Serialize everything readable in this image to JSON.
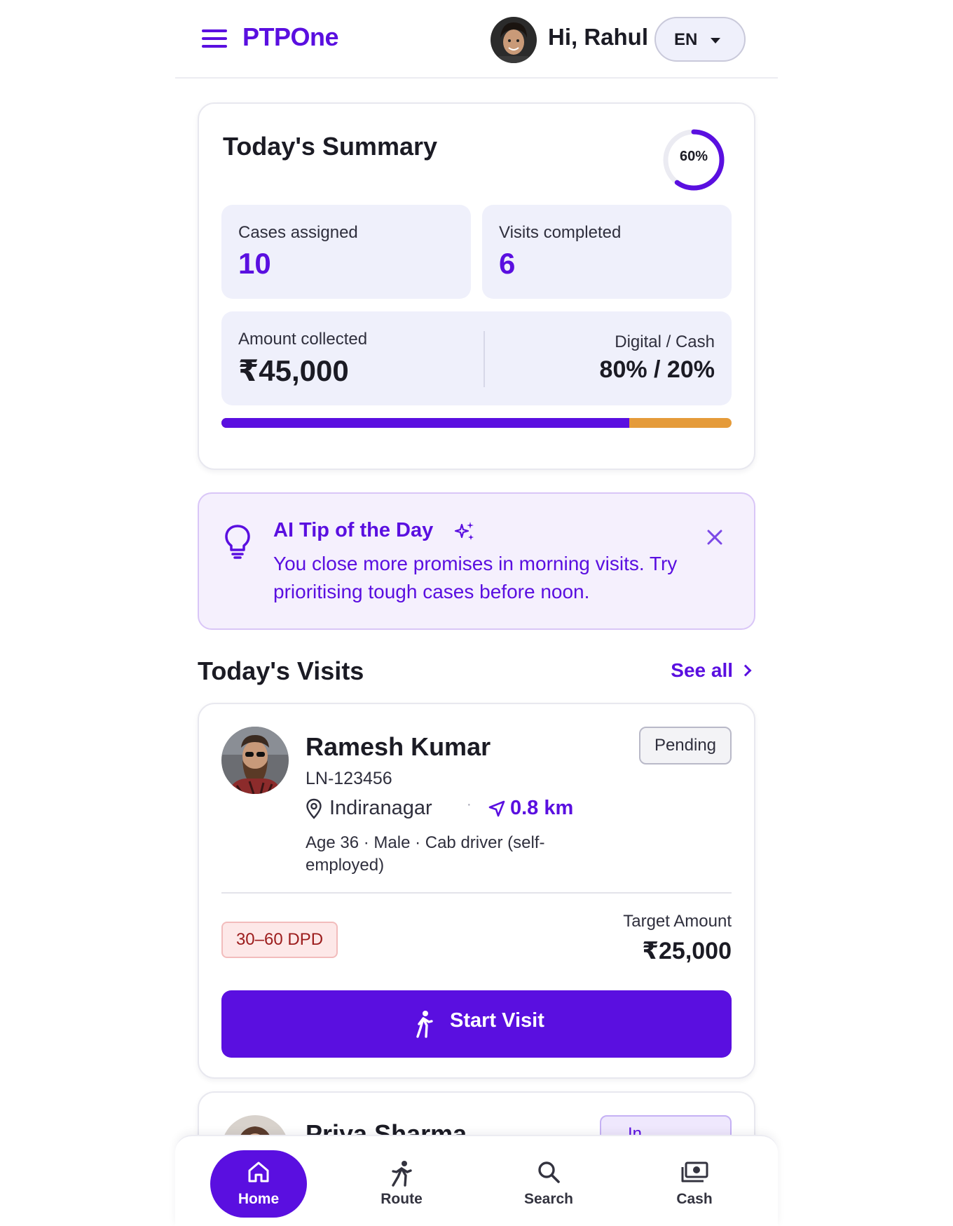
{
  "header": {
    "brand": "PTPOne",
    "greeting": "Hi, Rahul",
    "language": "EN"
  },
  "summary": {
    "title": "Today's Summary",
    "progress_label": "60%",
    "progress_fraction": 0.6,
    "cases_label": "Cases assigned",
    "cases_value": "10",
    "visits_label": "Visits completed",
    "visits_value": "6",
    "amount_label": "Amount collected",
    "amount_value": "₹45,000",
    "split_label": "Digital / Cash",
    "split_value": "80% / 20%",
    "digital_fraction": 0.8,
    "colors": {
      "digital": "#5a0fe0",
      "cash": "#e59b3a"
    }
  },
  "tip": {
    "title": "AI Tip of the Day",
    "body": "You close more promises in morning visits. Try prioritising tough cases before noon."
  },
  "visits": {
    "title": "Today's Visits",
    "see_all": "See all",
    "items": [
      {
        "name": "Ramesh Kumar",
        "loan_id": "LN-123456",
        "area": "Indiranagar",
        "distance": "0.8 km",
        "meta": "Age 36 · Male · Cab driver (self-employed)",
        "status": "Pending",
        "dpd": "30–60 DPD",
        "target_label": "Target Amount",
        "target_value": "₹25,000",
        "action": "Start Visit"
      },
      {
        "name": "Priya Sharma",
        "status": "In"
      }
    ]
  },
  "bottom_nav": {
    "items": [
      {
        "label": "Home",
        "icon": "home-icon"
      },
      {
        "label": "Route",
        "icon": "runner-icon"
      },
      {
        "label": "Search",
        "icon": "search-icon"
      },
      {
        "label": "Cash",
        "icon": "cash-icon"
      }
    ]
  },
  "theme": {
    "accent": "#5a0fe0"
  }
}
